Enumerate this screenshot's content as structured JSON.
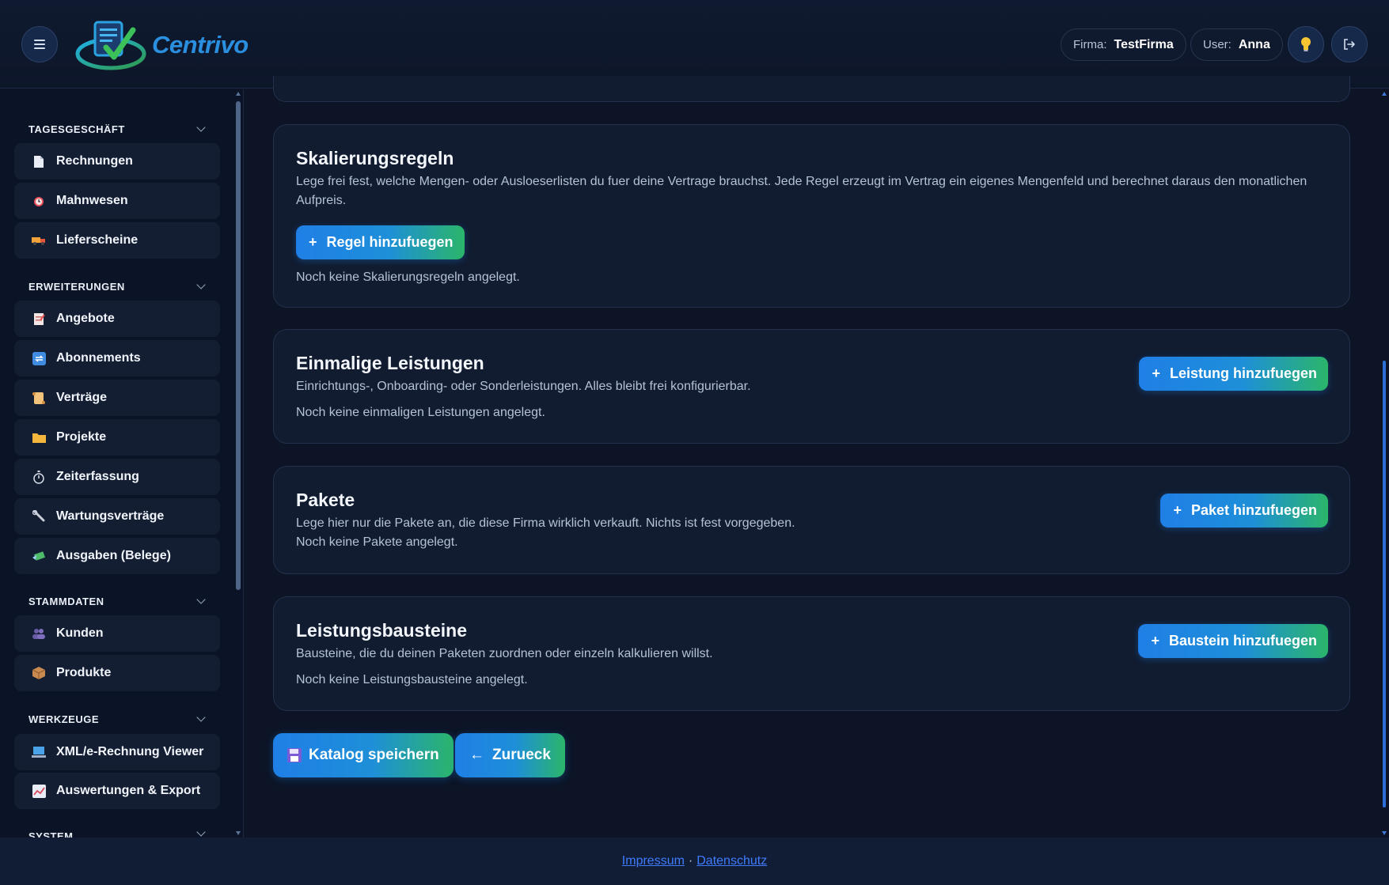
{
  "header": {
    "logo_text": "Centrivo",
    "firma_label": "Firma:",
    "firma_value": "TestFirma",
    "user_label": "User:",
    "user_value": "Anna"
  },
  "sidebar": {
    "sections": [
      {
        "title": "TAGESGESCHÄFT",
        "items": [
          "Rechnungen",
          "Mahnwesen",
          "Lieferscheine"
        ]
      },
      {
        "title": "ERWEITERUNGEN",
        "items": [
          "Angebote",
          "Abonnements",
          "Verträge",
          "Projekte",
          "Zeiterfassung",
          "Wartungsverträge",
          "Ausgaben (Belege)"
        ]
      },
      {
        "title": "STAMMDATEN",
        "items": [
          "Kunden",
          "Produkte"
        ]
      },
      {
        "title": "WERKZEUGE",
        "items": [
          "XML/e-Rechnung Viewer",
          "Auswertungen & Export"
        ]
      },
      {
        "title": "SYSTEM",
        "items": []
      }
    ]
  },
  "main": {
    "skalierung": {
      "title": "Skalierungsregeln",
      "description": "Lege frei fest, welche Mengen- oder Ausloeserlisten du fuer deine Vertrage brauchst. Jede Regel erzeugt im Vertrag ein eigenes Mengenfeld und berechnet daraus den monatlichen Aufpreis.",
      "button": "Regel hinzufuegen",
      "empty": "Noch keine Skalierungsregeln angelegt."
    },
    "einmalig": {
      "title": "Einmalige Leistungen",
      "description": "Einrichtungs-, Onboarding- oder Sonderleistungen. Alles bleibt frei konfigurierbar.",
      "empty": "Noch keine einmaligen Leistungen angelegt.",
      "button": "Leistung hinzufuegen"
    },
    "pakete": {
      "title": "Pakete",
      "description": "Lege hier nur die Pakete an, die diese Firma wirklich verkauft. Nichts ist fest vorgegeben.",
      "empty": "Noch keine Pakete angelegt.",
      "button": "Paket hinzufuegen"
    },
    "bausteine": {
      "title": "Leistungsbausteine",
      "description": "Bausteine, die du deinen Paketen zuordnen oder einzeln kalkulieren willst.",
      "empty": "Noch keine Leistungsbausteine angelegt.",
      "button": "Baustein hinzufuegen"
    },
    "save_button": "Katalog speichern",
    "back_button": "Zurueck",
    "plus_symbol": "+",
    "back_arrow": "←"
  },
  "footer": {
    "impressum": "Impressum",
    "separator": "·",
    "datenschutz": "Datenschutz"
  },
  "colors": {
    "background": "#0c1426",
    "card": "#111c31",
    "accent_blue": "#1f7fe6",
    "accent_green": "#2bb56a",
    "link": "#3f7cff"
  }
}
